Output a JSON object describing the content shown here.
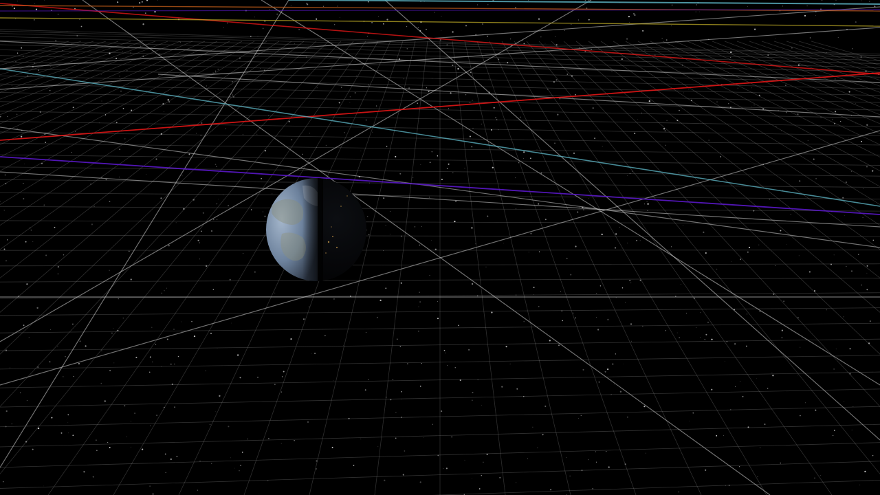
{
  "scene": {
    "type": "3d-space-viewer",
    "body": "earth",
    "view": "perspective",
    "grid": true,
    "starfield": true,
    "orbit_lines": true
  },
  "colors": {
    "background": "#000000",
    "grid_line": "#9a9a9a",
    "star": "#ffffff",
    "orbit_red": "#e01616",
    "orbit_purple": "#5a18c8",
    "orbit_cyan": "#5fb8c8",
    "orbit_orange": "#d2641c",
    "orbit_yellow": "#c8b428",
    "orbit_white": "#cfcfcf",
    "earth_day": "#7d93b0",
    "earth_night": "#050608"
  },
  "icons": {
    "earth": "earth-globe-icon"
  }
}
